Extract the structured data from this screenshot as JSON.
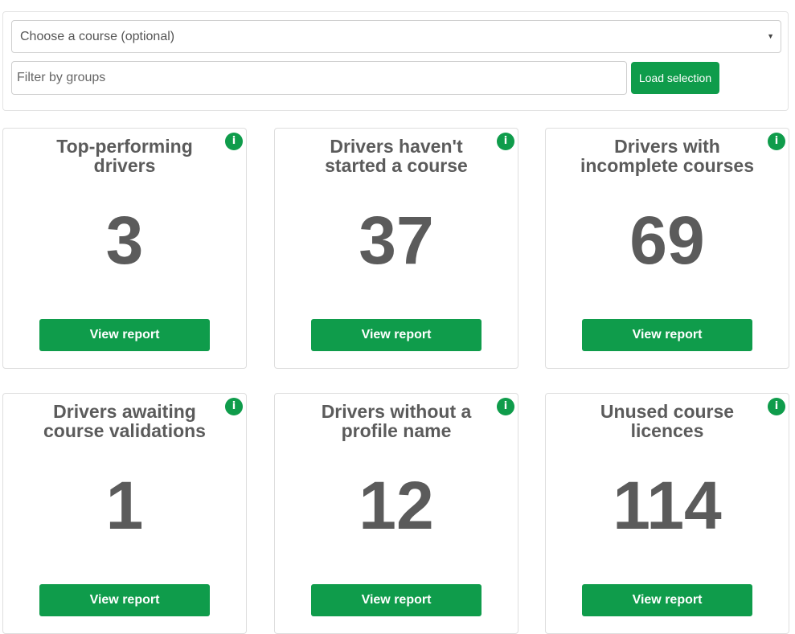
{
  "filters": {
    "course_select": "Choose a course (optional)",
    "group_placeholder": "Filter by groups",
    "load_label": "Load selection"
  },
  "info_label": "i",
  "cards": [
    {
      "title": "Top-performing drivers",
      "value": "3",
      "button": "View report"
    },
    {
      "title": "Drivers haven't started a course",
      "value": "37",
      "button": "View report"
    },
    {
      "title": "Drivers with incomplete courses",
      "value": "69",
      "button": "View report"
    },
    {
      "title": "Drivers awaiting course validations",
      "value": "1",
      "button": "View report"
    },
    {
      "title": "Drivers without a profile name",
      "value": "12",
      "button": "View report"
    },
    {
      "title": "Unused course licences",
      "value": "114",
      "button": "View report"
    }
  ],
  "colors": {
    "accent": "#0f9c4b",
    "text": "#5b5b5b",
    "border": "#dedede"
  }
}
